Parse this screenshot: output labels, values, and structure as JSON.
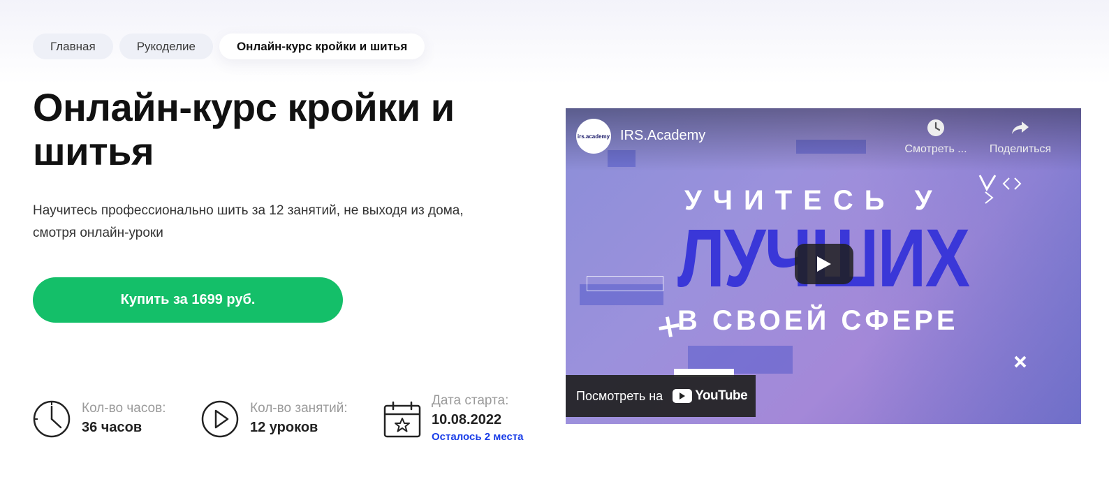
{
  "breadcrumbs": [
    {
      "label": "Главная"
    },
    {
      "label": "Рукоделие"
    },
    {
      "label": "Онлайн-курс кройки и шитья"
    }
  ],
  "page": {
    "title": "Онлайн-курс кройки и шитья",
    "subtitle": "Научитесь профессионально шить за 12 занятий, не выходя из дома, смотря онлайн-уроки",
    "buy_button": "Купить за 1699 руб.",
    "accent_color": "#14bf69"
  },
  "stats": {
    "hours": {
      "label": "Кол-во часов:",
      "value": "36 часов",
      "icon": "clock-icon"
    },
    "lessons": {
      "label": "Кол-во занятий:",
      "value": "12 уроков",
      "icon": "play-circle-icon"
    },
    "start": {
      "label": "Дата старта:",
      "value": "10.08.2022",
      "note": "Осталось 2 места",
      "icon": "calendar-star-icon"
    }
  },
  "video": {
    "channel_logo_text": "irs.academy",
    "channel_name": "IRS.Academy",
    "watch_later": "Смотреть ...",
    "share": "Поделиться",
    "promo_line1": "УЧИТЕСЬ У",
    "promo_big": "ЛУЧШИХ",
    "promo_line3": "В СВОЕЙ СФЕРЕ",
    "watch_on": "Посмотреть на",
    "youtube_label": "YouTube"
  }
}
